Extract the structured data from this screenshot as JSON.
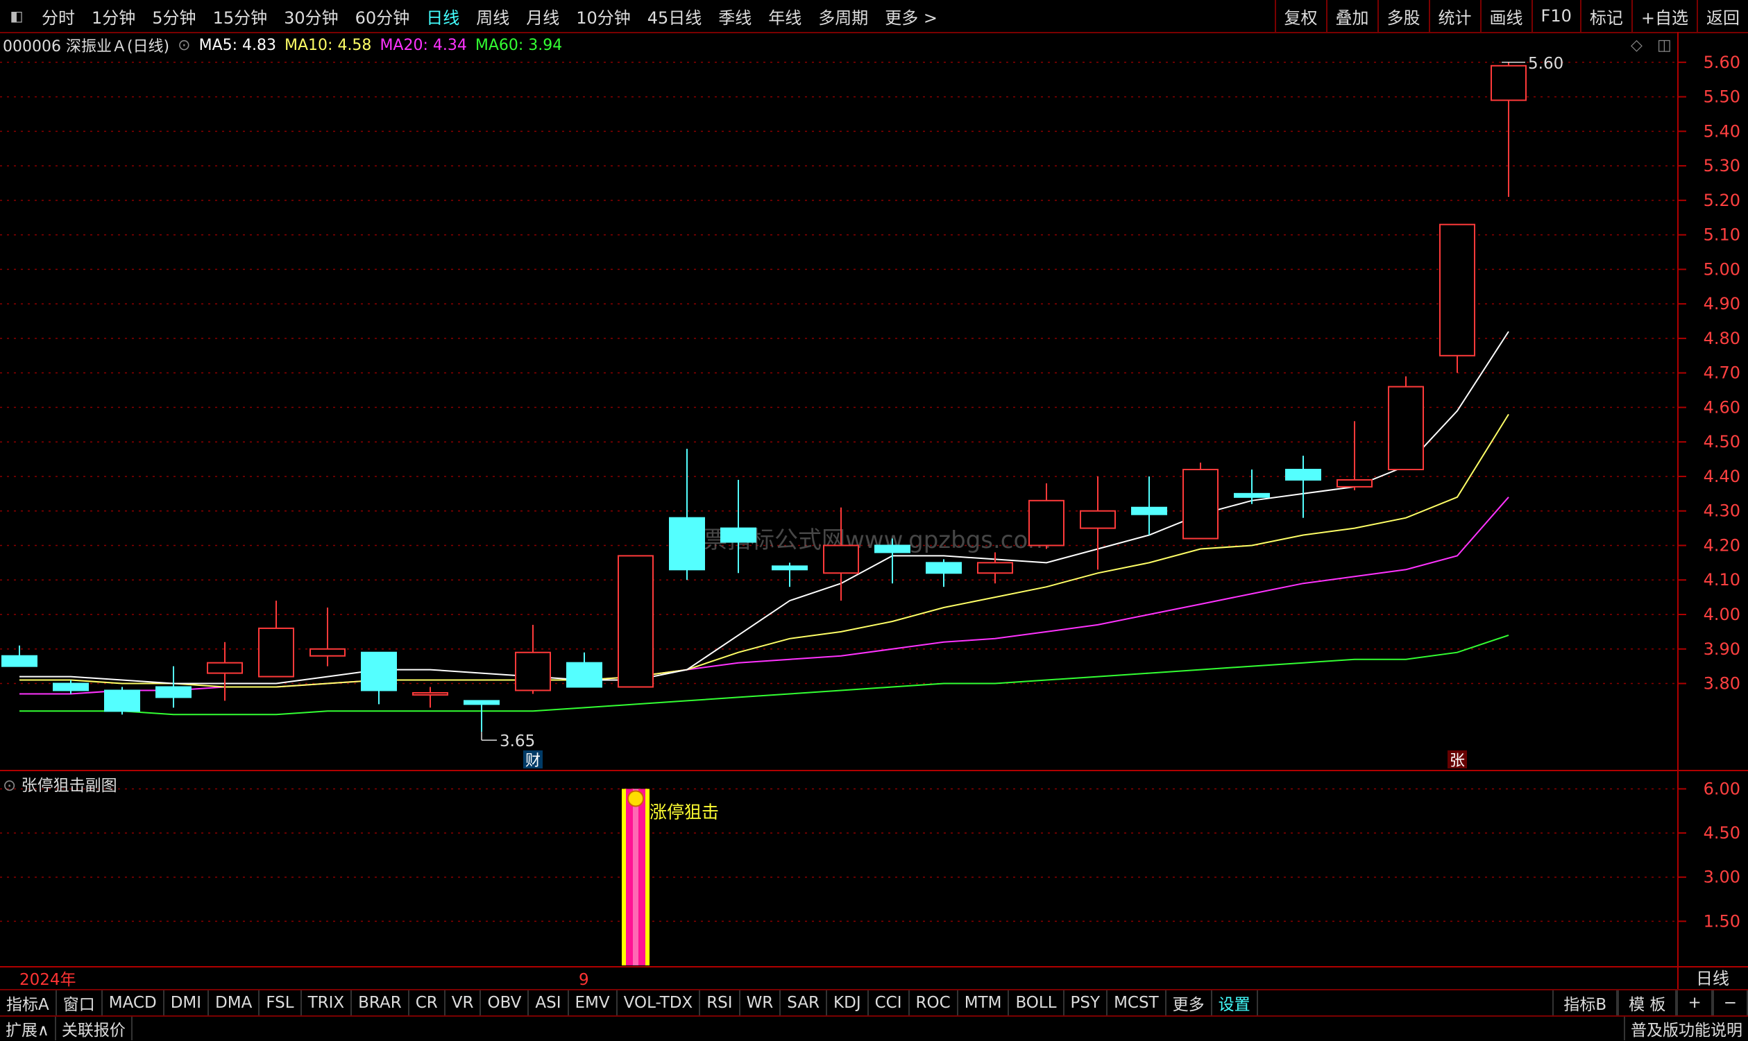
{
  "toolbar": {
    "periods": [
      "分时",
      "1分钟",
      "5分钟",
      "15分钟",
      "30分钟",
      "60分钟",
      "日线",
      "周线",
      "月线",
      "10分钟",
      "45日线",
      "季线",
      "年线",
      "多周期",
      "更多 >"
    ],
    "active_period": "日线",
    "tools": [
      "复权",
      "叠加",
      "多股",
      "统计",
      "画线",
      "F10",
      "标记",
      "+自选",
      "返回"
    ]
  },
  "stock": {
    "title": "000006 深振业Ａ(日线)",
    "ma5_label": "MA5: 4.83",
    "ma10_label": "MA10: 4.58",
    "ma20_label": "MA20: 4.34",
    "ma60_label": "MA60: 3.94"
  },
  "colors": {
    "up": "#ff3a3a",
    "down": "#54ffff",
    "ma5": "#ffffff",
    "ma10": "#ffff66",
    "ma20": "#ff33ff",
    "ma60": "#33ff33",
    "grid": "#8b0000",
    "signal": "#ff1493",
    "signal_edge": "#ffff00"
  },
  "chart_data": [
    {
      "type": "candlestick",
      "ylim": [
        3.58,
        5.68
      ],
      "y_ticks": [
        "5.60",
        "5.50",
        "5.40",
        "5.30",
        "5.20",
        "5.10",
        "5.00",
        "4.90",
        "4.80",
        "4.70",
        "4.60",
        "4.50",
        "4.40",
        "4.30",
        "4.20",
        "4.10",
        "4.00",
        "3.90",
        "3.80"
      ],
      "ohlc": [
        [
          3.88,
          3.91,
          3.85,
          3.85
        ],
        [
          3.8,
          3.81,
          3.77,
          3.78
        ],
        [
          3.78,
          3.79,
          3.71,
          3.72
        ],
        [
          3.79,
          3.85,
          3.73,
          3.76
        ],
        [
          3.83,
          3.92,
          3.75,
          3.86
        ],
        [
          3.82,
          4.04,
          3.82,
          3.96
        ],
        [
          3.88,
          4.02,
          3.85,
          3.9
        ],
        [
          3.89,
          3.89,
          3.74,
          3.78
        ],
        [
          3.77,
          3.79,
          3.73,
          3.77
        ],
        [
          3.75,
          3.75,
          3.66,
          3.74
        ],
        [
          3.78,
          3.97,
          3.77,
          3.89
        ],
        [
          3.86,
          3.89,
          3.79,
          3.79
        ],
        [
          3.79,
          4.17,
          3.79,
          4.17
        ],
        [
          4.28,
          4.48,
          4.1,
          4.13
        ],
        [
          4.25,
          4.39,
          4.12,
          4.21
        ],
        [
          4.14,
          4.15,
          4.08,
          4.13
        ],
        [
          4.12,
          4.31,
          4.04,
          4.2
        ],
        [
          4.2,
          4.22,
          4.09,
          4.18
        ],
        [
          4.15,
          4.16,
          4.08,
          4.12
        ],
        [
          4.12,
          4.18,
          4.09,
          4.15
        ],
        [
          4.2,
          4.38,
          4.19,
          4.33
        ],
        [
          4.25,
          4.4,
          4.13,
          4.3
        ],
        [
          4.31,
          4.4,
          4.23,
          4.29
        ],
        [
          4.22,
          4.44,
          4.22,
          4.42
        ],
        [
          4.35,
          4.42,
          4.32,
          4.34
        ],
        [
          4.42,
          4.46,
          4.28,
          4.39
        ],
        [
          4.37,
          4.56,
          4.36,
          4.39
        ],
        [
          4.42,
          4.69,
          4.42,
          4.66
        ],
        [
          4.75,
          5.13,
          4.7,
          5.13
        ],
        [
          5.49,
          5.6,
          5.21,
          5.59
        ]
      ],
      "ma5": [
        3.82,
        3.82,
        3.81,
        3.8,
        3.8,
        3.8,
        3.82,
        3.84,
        3.84,
        3.83,
        3.82,
        3.81,
        3.81,
        3.84,
        3.94,
        4.04,
        4.09,
        4.17,
        4.17,
        4.16,
        4.15,
        4.19,
        4.23,
        4.29,
        4.33,
        4.35,
        4.37,
        4.43,
        4.59,
        4.82
      ],
      "ma10": [
        3.81,
        3.81,
        3.8,
        3.8,
        3.79,
        3.79,
        3.8,
        3.81,
        3.81,
        3.81,
        3.81,
        3.81,
        3.82,
        3.84,
        3.89,
        3.93,
        3.95,
        3.98,
        4.02,
        4.05,
        4.08,
        4.12,
        4.15,
        4.19,
        4.2,
        4.23,
        4.25,
        4.28,
        4.34,
        4.58
      ],
      "ma20": [
        3.77,
        3.77,
        3.78,
        3.78,
        3.79,
        3.79,
        3.8,
        3.81,
        3.81,
        3.81,
        3.81,
        3.81,
        3.82,
        3.84,
        3.86,
        3.87,
        3.88,
        3.9,
        3.92,
        3.93,
        3.95,
        3.97,
        4.0,
        4.03,
        4.06,
        4.09,
        4.11,
        4.13,
        4.17,
        4.34
      ],
      "ma60": [
        3.72,
        3.72,
        3.72,
        3.71,
        3.71,
        3.71,
        3.72,
        3.72,
        3.72,
        3.72,
        3.72,
        3.73,
        3.74,
        3.75,
        3.76,
        3.77,
        3.78,
        3.79,
        3.8,
        3.8,
        3.81,
        3.82,
        3.83,
        3.84,
        3.85,
        3.86,
        3.87,
        3.87,
        3.89,
        3.94
      ],
      "high_label": "5.60",
      "low_label": "3.65",
      "markers": [
        {
          "index": 10,
          "text": "财"
        },
        {
          "index": 28,
          "text": "张"
        }
      ]
    },
    {
      "type": "bar",
      "title": "张停狙击副图",
      "ylim": [
        0,
        6.6
      ],
      "y_ticks": [
        "6.00",
        "4.50",
        "3.00",
        "1.50"
      ],
      "signal_index": 12,
      "signal_value": 6.0,
      "signal_label": "涨停狙击"
    }
  ],
  "axis": {
    "year_label": "2024年",
    "month_label": "9",
    "period_label": "日线"
  },
  "watermark": "股票指标公式网www.gpzbgs.com",
  "tabs": [
    "指标A",
    "窗口",
    "MACD",
    "DMI",
    "DMA",
    "FSL",
    "TRIX",
    "BRAR",
    "CR",
    "VR",
    "OBV",
    "ASI",
    "EMV",
    "VOL-TDX",
    "RSI",
    "WR",
    "SAR",
    "KDJ",
    "CCI",
    "ROC",
    "MTM",
    "BOLL",
    "PSY",
    "MCST",
    "更多",
    "设置"
  ],
  "tabs_active": "设置",
  "right_tabs": [
    "指标B",
    "模 板",
    "+",
    "−"
  ],
  "status": {
    "left1": "扩展∧",
    "left2": "关联报价",
    "right": "普及版功能说明"
  }
}
